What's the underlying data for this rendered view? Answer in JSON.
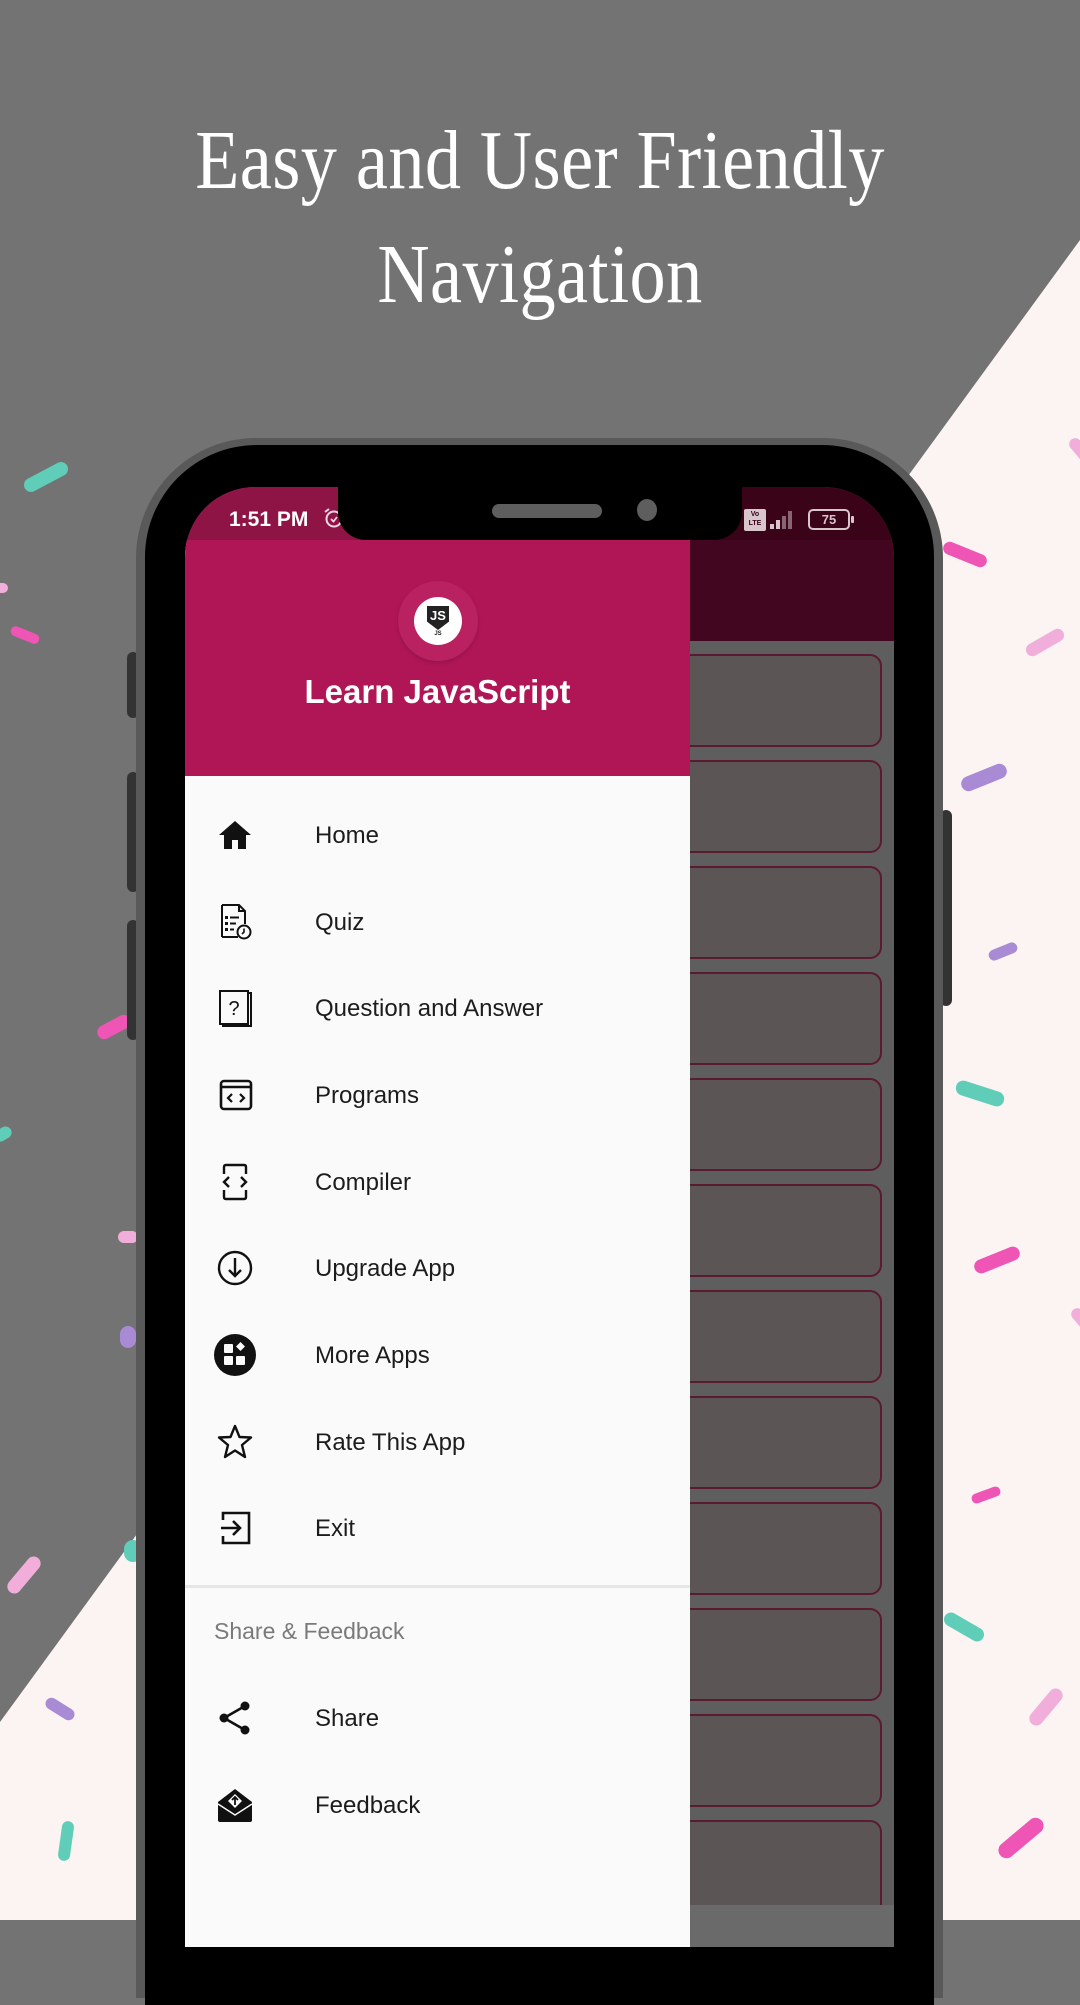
{
  "promo": {
    "headline_line1": "Easy and User Friendly",
    "headline_line2": "Navigation"
  },
  "colors": {
    "background_gray": "#737373",
    "background_cream": "#fbf4f2",
    "brand_primary": "#b01655",
    "status_bar": "#8f1446",
    "scrim_appbar": "#420620",
    "confetti_teal": "#5fcdb7",
    "confetti_pink": "#ee55b5",
    "confetti_light_pink": "#f2aedb",
    "confetti_purple": "#a98ad4"
  },
  "status_bar": {
    "time": "1:51 PM",
    "alarm_icon": "alarm-icon",
    "network_badge": "Vo LTE",
    "signal_icon": "signal-icon",
    "battery_level": "75"
  },
  "drawer": {
    "app_title": "Learn JavaScript",
    "logo_text": "JS",
    "logo_caption": "JS",
    "items": [
      {
        "label": "Home",
        "icon": "home-icon"
      },
      {
        "label": "Quiz",
        "icon": "quiz-icon"
      },
      {
        "label": "Question and Answer",
        "icon": "question-icon"
      },
      {
        "label": "Programs",
        "icon": "code-window-icon"
      },
      {
        "label": "Compiler",
        "icon": "compiler-icon"
      },
      {
        "label": "Upgrade App",
        "icon": "download-circle-icon"
      },
      {
        "label": "More Apps",
        "icon": "apps-icon"
      },
      {
        "label": "Rate This App",
        "icon": "star-icon"
      },
      {
        "label": "Exit",
        "icon": "exit-icon"
      }
    ],
    "section_label": "Share & Feedback",
    "section_items": [
      {
        "label": "Share",
        "icon": "share-icon"
      },
      {
        "label": "Feedback",
        "icon": "feedback-mail-icon"
      }
    ]
  }
}
